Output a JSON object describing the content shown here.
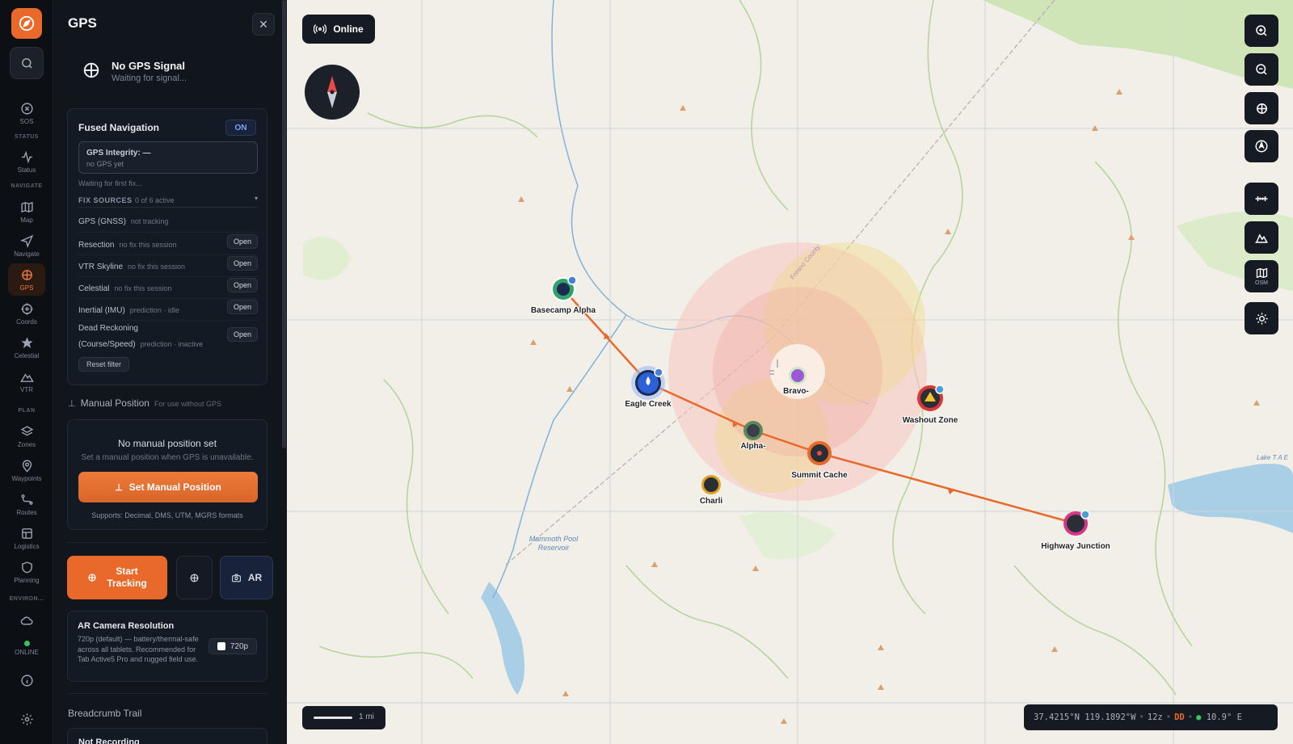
{
  "rail": {
    "items": [
      {
        "label": "SOS",
        "icon": "sos-icon"
      },
      {
        "label": "Status",
        "icon": "activity-icon"
      },
      {
        "label": "Map",
        "icon": "map-icon"
      },
      {
        "label": "Navigate",
        "icon": "navigate-icon"
      },
      {
        "label": "GPS",
        "icon": "crosshair-icon"
      },
      {
        "label": "Coords",
        "icon": "coords-icon"
      },
      {
        "label": "Celestial",
        "icon": "star-icon"
      },
      {
        "label": "VTR",
        "icon": "mountain-icon"
      },
      {
        "label": "Zones",
        "icon": "layers-icon"
      },
      {
        "label": "Waypoints",
        "icon": "pin-icon"
      },
      {
        "label": "Routes",
        "icon": "route-icon"
      },
      {
        "label": "Logistics",
        "icon": "box-icon"
      },
      {
        "label": "Planning",
        "icon": "shield-icon"
      },
      {
        "label": "ONLINE",
        "icon": "cloud-icon"
      }
    ],
    "sections": {
      "status": "STATUS",
      "navigate": "NAVIGATE",
      "plan": "PLAN",
      "environ": "ENVIRON..."
    }
  },
  "panel": {
    "title": "GPS",
    "gps_status": {
      "title": "No GPS Signal",
      "subtitle": "Waiting for signal..."
    },
    "fused": {
      "title": "Fused Navigation",
      "toggle": "ON",
      "integrity_title": "GPS Integrity: —",
      "integrity_sub": "no GPS yet",
      "waiting": "Waiting for first fix...",
      "fix_sources_label": "FIX SOURCES",
      "fix_sources_count": "0 of 6 active",
      "sources": [
        {
          "name": "GPS (GNSS)",
          "detail": "not tracking",
          "action": ""
        },
        {
          "name": "Resection",
          "detail": "no fix this session",
          "action": "Open"
        },
        {
          "name": "VTR Skyline",
          "detail": "no fix this session",
          "action": "Open"
        },
        {
          "name": "Celestial",
          "detail": "no fix this session",
          "action": "Open"
        },
        {
          "name": "Inertial (IMU)",
          "detail": "prediction · idle",
          "action": "Open"
        },
        {
          "name": "Dead Reckoning",
          "name2": "(Course/Speed)",
          "detail": "prediction · inactive",
          "action": "Open"
        }
      ],
      "reset": "Reset filter"
    },
    "manual": {
      "header": "Manual Position",
      "header_sub": "For use without GPS",
      "title": "No manual position set",
      "subtitle": "Set a manual position when GPS is unavailable.",
      "button": "Set Manual Position",
      "formats": "Supports: Decimal, DMS, UTM, MGRS formats"
    },
    "actions": {
      "start_line1": "Start",
      "start_line2": "Tracking",
      "ar": "AR"
    },
    "ar_camera": {
      "title": "AR Camera Resolution",
      "desc": "720p (default) — battery/thermal-safe across all tablets. Recommended for Tab Active5 Pro and rugged field use.",
      "value": "720p"
    },
    "breadcrumb": {
      "header": "Breadcrumb Trail",
      "status": "Not Recording"
    }
  },
  "map": {
    "status": "Online",
    "controls": [
      {
        "icon": "zoom-in-icon",
        "label": ""
      },
      {
        "icon": "zoom-out-icon",
        "label": ""
      },
      {
        "icon": "locate-icon",
        "label": ""
      },
      {
        "icon": "north-up-icon",
        "label": ""
      },
      {
        "icon": "measure-icon",
        "label": ""
      },
      {
        "icon": "elevation-icon",
        "label": ""
      },
      {
        "icon": "map-style-icon",
        "label": "OSM"
      },
      {
        "icon": "brightness-icon",
        "label": ""
      }
    ],
    "scale": "1 mi",
    "coords": {
      "lat": "37.4215°N",
      "lon": "119.1892°W",
      "zoom": "12z",
      "format": "DD",
      "temp": "10.9° E"
    },
    "waypoints": [
      {
        "name": "Basecamp Alpha",
        "color": "#2fa36b"
      },
      {
        "name": "Eagle Creek",
        "color": "#2d5fd6"
      },
      {
        "name": "Bravo-",
        "color": "#9b59d6"
      },
      {
        "name": "Alpha-",
        "color": "#5a8a5a"
      },
      {
        "name": "Summit Cache",
        "color": "#e8692a"
      },
      {
        "name": "Charli",
        "color": "#e0a020"
      },
      {
        "name": "Washout Zone",
        "color": "#d93636"
      },
      {
        "name": "Highway Junction",
        "color": "#d63686"
      }
    ],
    "labels": [
      "Mammoth Pool Reservoir",
      "Fresno County",
      "Lake T A E"
    ],
    "colors": {
      "accent": "#e8692a",
      "route": "#e8692a",
      "water": "#a8cfe6",
      "forest": "#cfe5b8"
    }
  }
}
